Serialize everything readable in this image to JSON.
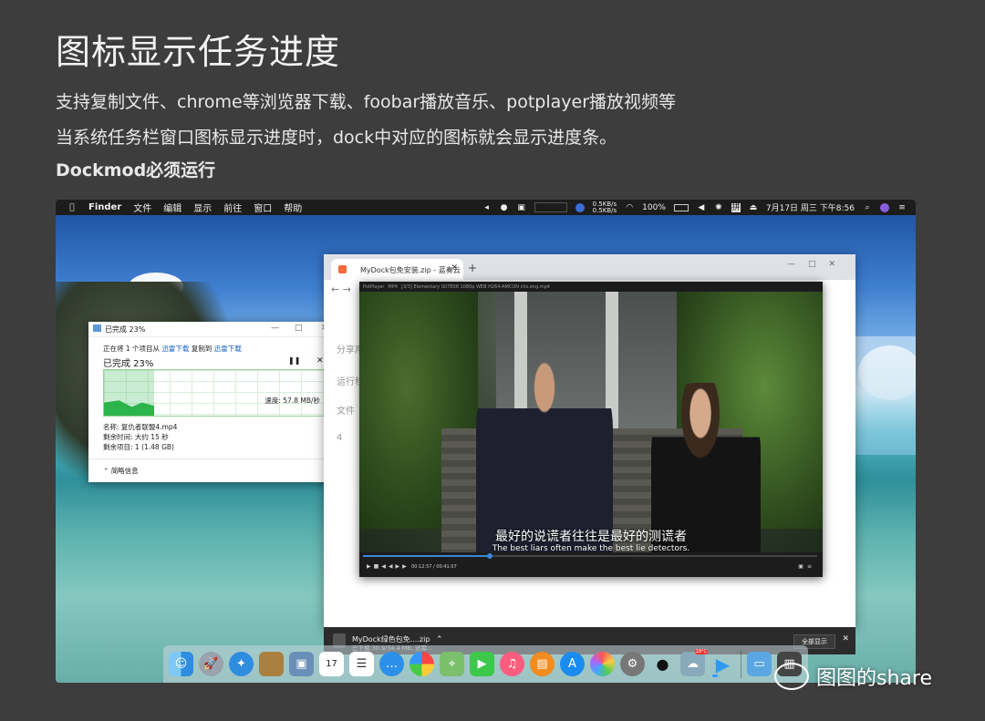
{
  "header": {
    "title": "图标显示任务进度",
    "line1": "支持复制文件、chrome等浏览器下载、foobar播放音乐、potplayer播放视频等",
    "line2": "当系统任务栏窗口图标显示进度时，dock中对应的图标就会显示进度条。",
    "line3": "Dockmod必须运行"
  },
  "menubar": {
    "items": [
      "Finder",
      "文件",
      "编辑",
      "显示",
      "前往",
      "窗口",
      "帮助"
    ],
    "net_up": "0.5KB/s",
    "net_down": "0.5KB/s",
    "battery": "100%",
    "datetime": "7月17日 周三 下午8:56",
    "input_method": "拼"
  },
  "copy_dialog": {
    "title": "已完成 23%",
    "line1_prefix": "正在将 1 个项目从",
    "source": "迅雷下载",
    "line1_mid": "复制到",
    "dest": "迅雷下载",
    "percent_label": "已完成 23%",
    "progress": 0.23,
    "speed": "速度: 57.8 MB/秒",
    "name": "名称: 复仇者联盟4.mp4",
    "time_left": "剩余时间: 大约 15 秒",
    "items_left": "剩余项目: 1 (1.48 GB)",
    "less_info": "简略信息"
  },
  "browser": {
    "tab_title": "MyDock包免安装.zip - 蓝奏云",
    "page_lines": [
      "分享用",
      "运行移",
      "文件",
      "4"
    ],
    "download_name": "MyDock绿色包免....zip",
    "download_status": "已下载 30.9/34.4 MB, 还需...",
    "show_all": "全部显示"
  },
  "player": {
    "app": "PotPlayer",
    "format": "MP4",
    "filename": "[3/3] Elementary S07E08 1080p WEB H264-AMCON chs.eng.mp4",
    "subtitle_cn": "最好的说谎者往往是最好的测谎者",
    "subtitle_en": "The best liars often make the best lie detectors.",
    "time": "00:12:57 / 00:41:07",
    "progress": 0.28
  },
  "dock": {
    "calendar_day": "17",
    "badge": "18°C"
  },
  "watermark": "图图的share",
  "colors": {
    "accent": "#3a86d8",
    "copy_green": "#2cb44a"
  }
}
